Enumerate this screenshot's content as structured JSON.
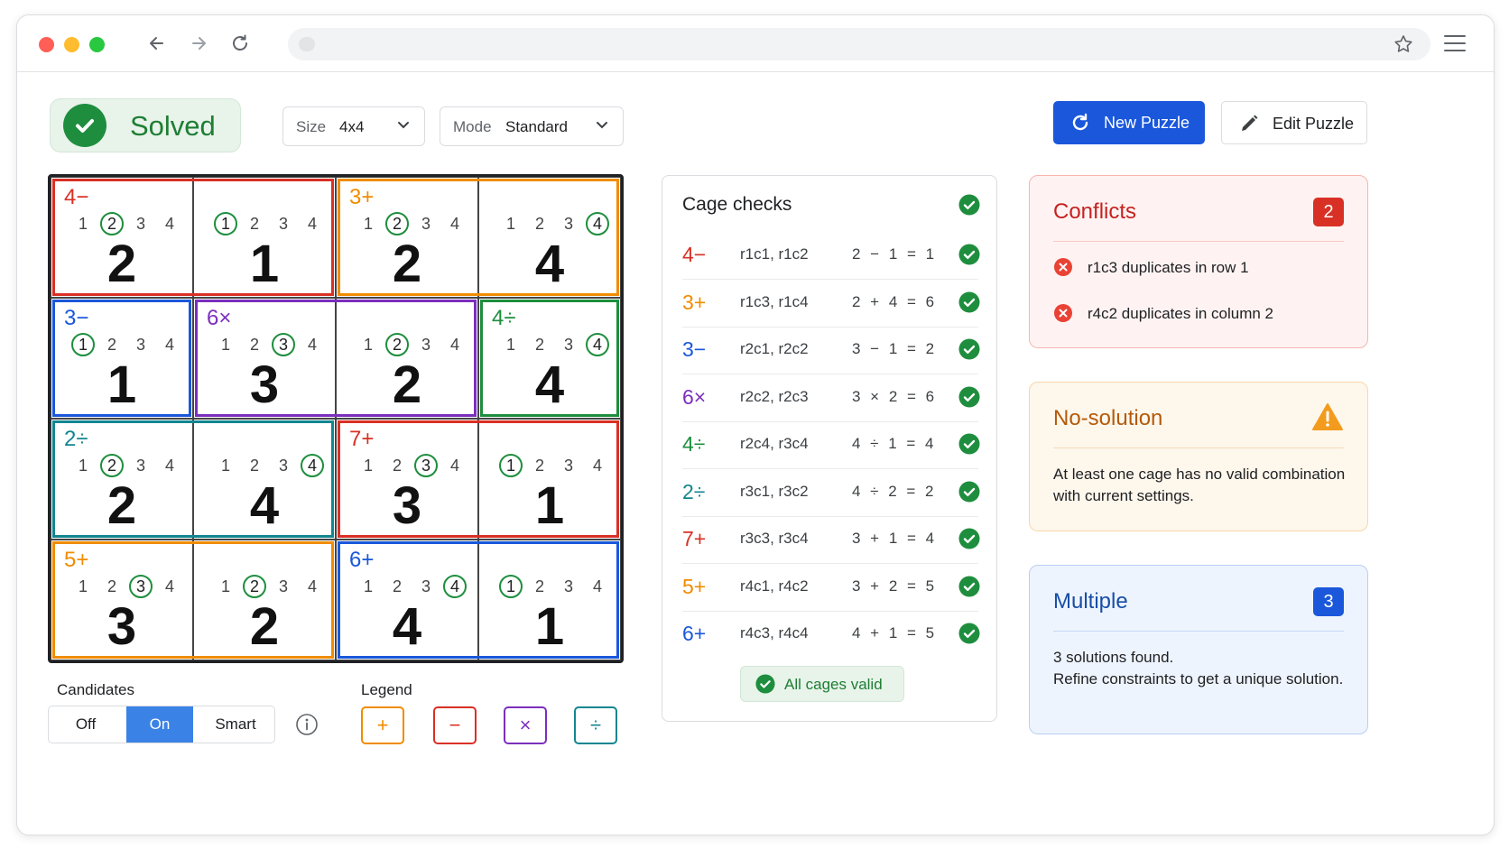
{
  "status": {
    "label": "Solved"
  },
  "controls": {
    "size": {
      "label": "Size",
      "value": "4x4"
    },
    "mode": {
      "label": "Mode",
      "value": "Standard"
    },
    "new_puzzle": "New Puzzle",
    "edit_puzzle": "Edit Puzzle"
  },
  "board": {
    "cells": [
      {
        "label": "4−",
        "cands": [
          "1",
          "2",
          "3",
          "4"
        ],
        "sel": 2,
        "value": "2",
        "color": "#d93025"
      },
      {
        "label": "",
        "cands": [
          "1",
          "2",
          "3",
          "4"
        ],
        "sel": 1,
        "value": "1",
        "color": "#d93025"
      },
      {
        "label": "3+",
        "cands": [
          "1",
          "2",
          "3",
          "4"
        ],
        "sel": 2,
        "value": "2",
        "color": "#f08c00"
      },
      {
        "label": "",
        "cands": [
          "1",
          "2",
          "3",
          "4"
        ],
        "sel": 4,
        "value": "4",
        "color": "#f08c00"
      },
      {
        "label": "3−",
        "cands": [
          "1",
          "2",
          "3",
          "4"
        ],
        "sel": 1,
        "value": "1",
        "color": "#1a57db"
      },
      {
        "label": "6×",
        "cands": [
          "1",
          "2",
          "3",
          "4"
        ],
        "sel": 3,
        "value": "3",
        "color": "#7b2fbe"
      },
      {
        "label": "",
        "cands": [
          "1",
          "2",
          "3",
          "4"
        ],
        "sel": 2,
        "value": "2",
        "color": "#7b2fbe"
      },
      {
        "label": "4÷",
        "cands": [
          "1",
          "2",
          "3",
          "4"
        ],
        "sel": 4,
        "value": "4",
        "color": "#1e8e3e"
      },
      {
        "label": "2÷",
        "cands": [
          "1",
          "2",
          "3",
          "4"
        ],
        "sel": 2,
        "value": "2",
        "color": "#12868f"
      },
      {
        "label": "",
        "cands": [
          "1",
          "2",
          "3",
          "4"
        ],
        "sel": 4,
        "value": "4",
        "color": "#12868f"
      },
      {
        "label": "7+",
        "cands": [
          "1",
          "2",
          "3",
          "4"
        ],
        "sel": 3,
        "value": "3",
        "color": "#d93025"
      },
      {
        "label": "",
        "cands": [
          "1",
          "2",
          "3",
          "4"
        ],
        "sel": 1,
        "value": "1",
        "color": "#d93025"
      },
      {
        "label": "5+",
        "cands": [
          "1",
          "2",
          "3",
          "4"
        ],
        "sel": 3,
        "value": "3",
        "color": "#f08c00"
      },
      {
        "label": "",
        "cands": [
          "1",
          "2",
          "3",
          "4"
        ],
        "sel": 2,
        "value": "2",
        "color": "#f08c00"
      },
      {
        "label": "6+",
        "cands": [
          "1",
          "2",
          "3",
          "4"
        ],
        "sel": 4,
        "value": "4",
        "color": "#1a57db"
      },
      {
        "label": "",
        "cands": [
          "1",
          "2",
          "3",
          "4"
        ],
        "sel": 1,
        "value": "1",
        "color": "#1a57db"
      }
    ]
  },
  "candidates": {
    "title": "Candidates",
    "options": [
      "Off",
      "On",
      "Smart"
    ],
    "selected": "On"
  },
  "legend": {
    "title": "Legend",
    "items": [
      {
        "symbol": "+",
        "color": "#f08c00"
      },
      {
        "symbol": "−",
        "color": "#d93025"
      },
      {
        "symbol": "×",
        "color": "#7b2fbe"
      },
      {
        "symbol": "÷",
        "color": "#12868f"
      }
    ]
  },
  "cage_checks": {
    "title": "Cage checks",
    "rows": [
      {
        "op": "4−",
        "cells": "r1c1, r1c2",
        "eq": "2 − 1 = 1",
        "color": "#d93025"
      },
      {
        "op": "3+",
        "cells": "r1c3, r1c4",
        "eq": "2 + 4 = 6",
        "color": "#f08c00"
      },
      {
        "op": "3−",
        "cells": "r2c1, r2c2",
        "eq": "3 − 1 = 2",
        "color": "#1a57db"
      },
      {
        "op": "6×",
        "cells": "r2c2, r2c3",
        "eq": "3 × 2 = 6",
        "color": "#7b2fbe"
      },
      {
        "op": "4÷",
        "cells": "r2c4, r3c4",
        "eq": "4 ÷ 1 = 4",
        "color": "#1e8e3e"
      },
      {
        "op": "2÷",
        "cells": "r3c1, r3c2",
        "eq": "4 ÷ 2 = 2",
        "color": "#12868f"
      },
      {
        "op": "7+",
        "cells": "r3c3, r3c4",
        "eq": "3 + 1 = 4",
        "color": "#d93025"
      },
      {
        "op": "5+",
        "cells": "r4c1, r4c2",
        "eq": "3 + 2 = 5",
        "color": "#f08c00"
      },
      {
        "op": "6+",
        "cells": "r4c3, r4c4",
        "eq": "4 + 1 = 5",
        "color": "#1a57db"
      }
    ],
    "all_valid": "All cages valid"
  },
  "conflicts": {
    "title": "Conflicts",
    "count": "2",
    "items": [
      "r1c3 duplicates in row 1",
      "r4c2 duplicates in column 2"
    ]
  },
  "no_solution": {
    "title": "No-solution",
    "text": "At least one cage has no valid combination with current settings."
  },
  "multiple": {
    "title": "Multiple",
    "count": "3",
    "line1": "3 solutions found.",
    "line2": "Refine constraints to get a unique solution."
  },
  "colors": {
    "accent": "#1a57db",
    "success": "#1e8e3e",
    "danger": "#d93025",
    "warning": "#f08c00"
  },
  "icons": [
    "back-arrow-icon",
    "forward-arrow-icon",
    "reload-icon",
    "bookmark-star-icon",
    "menu-icon",
    "check-icon",
    "refresh-icon",
    "pencil-icon",
    "chevron-down-icon",
    "info-icon",
    "error-x-icon",
    "warning-triangle-icon"
  ]
}
